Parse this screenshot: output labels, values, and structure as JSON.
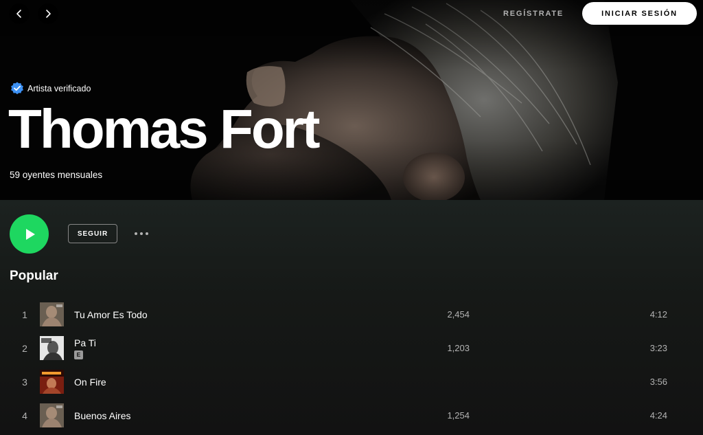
{
  "nav": {
    "back_icon": "chevron-left-icon",
    "forward_icon": "chevron-right-icon",
    "signup_label": "REGÍSTRATE",
    "login_label": "INICIAR SESIÓN"
  },
  "artist": {
    "verified_label": "Artista verificado",
    "verified_icon": "verified-badge-icon",
    "name": "Thomas Fort",
    "monthly_listeners": "59 oyentes mensuales"
  },
  "actions": {
    "play_icon": "play-icon",
    "follow_label": "SEGUIR",
    "more_icon": "more-options-icon"
  },
  "popular": {
    "title": "Popular",
    "tracks": [
      {
        "number": "1",
        "title": "Tu Amor Es Todo",
        "explicit": false,
        "plays": "2,454",
        "duration": "4:12"
      },
      {
        "number": "2",
        "title": "Pa Ti",
        "explicit": true,
        "explicit_label": "E",
        "plays": "1,203",
        "duration": "3:23"
      },
      {
        "number": "3",
        "title": "On Fire",
        "explicit": false,
        "plays": "",
        "duration": "3:56"
      },
      {
        "number": "4",
        "title": "Buenos Aires",
        "explicit": false,
        "plays": "1,254",
        "duration": "4:24"
      }
    ]
  },
  "colors": {
    "accent_green": "#1ed760",
    "background": "#121212",
    "text_secondary": "#b3b3b3",
    "verified_blue": "#3d91f4"
  }
}
